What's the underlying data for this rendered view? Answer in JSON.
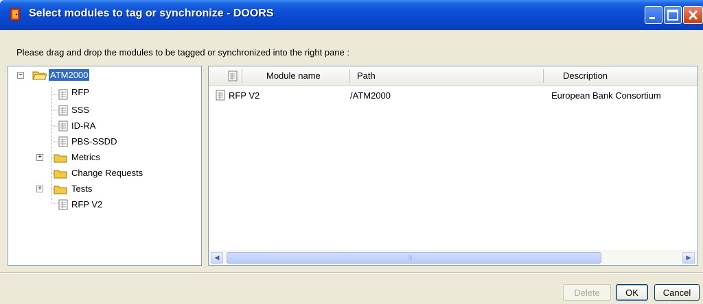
{
  "window": {
    "title": "Select modules to tag or synchronize - DOORS",
    "icon": "doors-app-icon"
  },
  "instruction": "Please drag and drop the modules to be tagged or synchronized into the right pane :",
  "tree": {
    "root": {
      "label": "ATM2000",
      "icon": "folder-open-icon",
      "expanded": true,
      "selected": true
    },
    "children": [
      {
        "label": "RFP",
        "icon": "module-icon"
      },
      {
        "label": "SSS",
        "icon": "module-icon"
      },
      {
        "label": "ID-RA",
        "icon": "module-icon"
      },
      {
        "label": "PBS-SSDD",
        "icon": "module-icon"
      },
      {
        "label": "Metrics",
        "icon": "folder-icon",
        "expandable": true
      },
      {
        "label": "Change Requests",
        "icon": "folder-icon"
      },
      {
        "label": "Tests",
        "icon": "folder-icon",
        "expandable": true
      },
      {
        "label": "RFP V2",
        "icon": "module-icon"
      }
    ]
  },
  "list": {
    "columns": [
      "Module name",
      "Path",
      "Description"
    ],
    "rows": [
      {
        "name": "RFP V2",
        "path": "/ATM2000",
        "description": "European Bank Consortium"
      }
    ]
  },
  "buttons": {
    "delete": "Delete",
    "ok": "OK",
    "cancel": "Cancel"
  },
  "colors": {
    "titlebar": "#0a4fd6",
    "selection": "#316ac5",
    "folder": "#f5c842",
    "dialog_bg": "#ece9d8"
  }
}
